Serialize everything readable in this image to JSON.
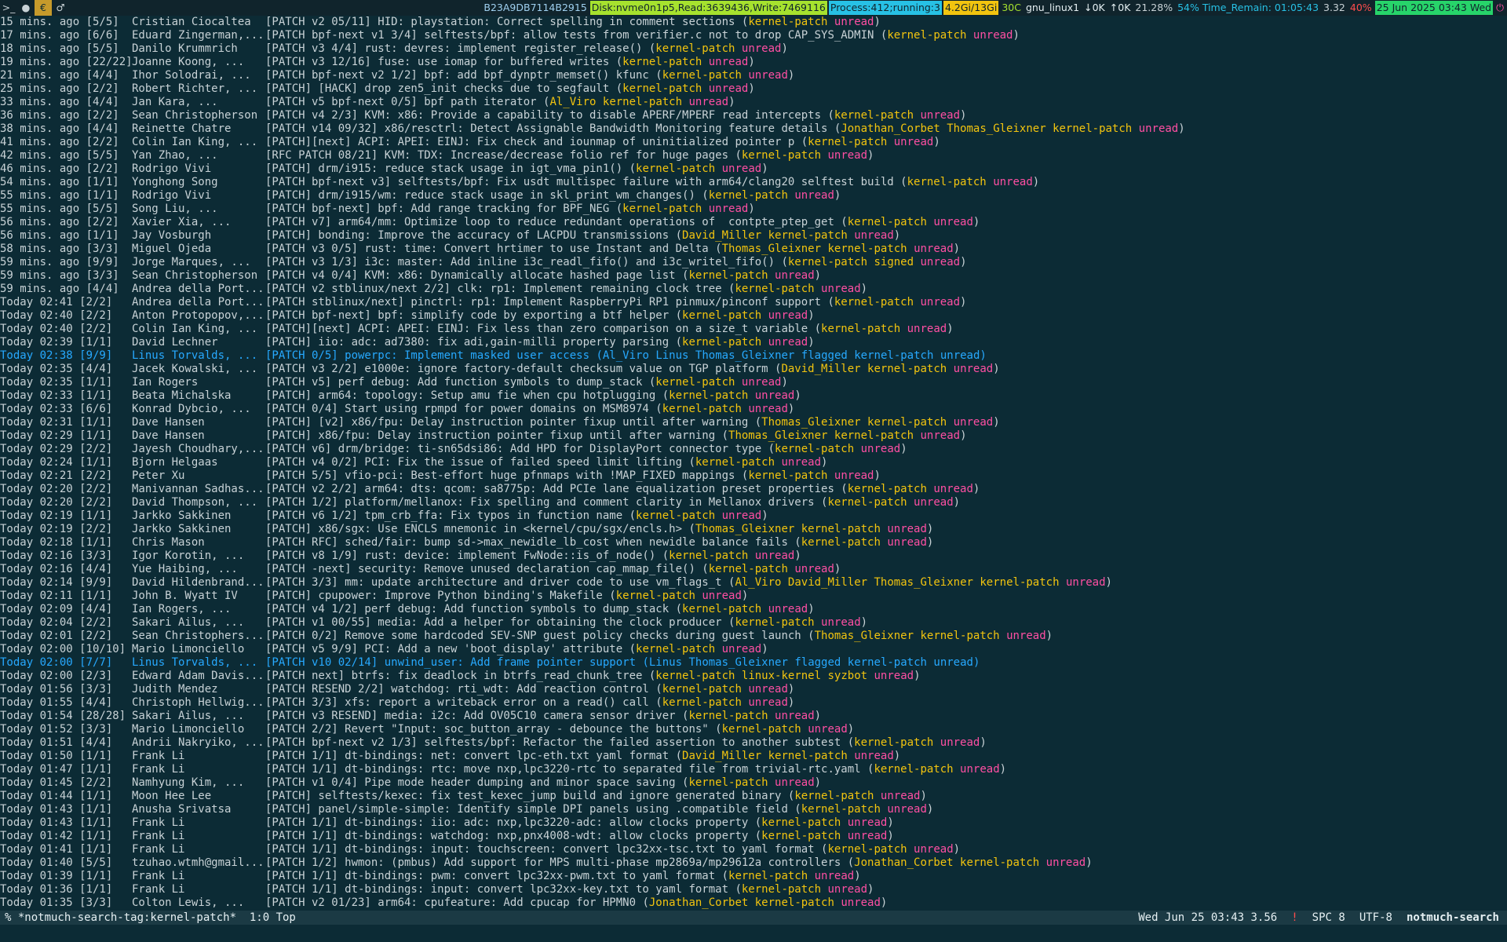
{
  "topbar": {
    "workspaces": [
      ">_",
      "●",
      "€",
      "♂"
    ],
    "active_workspace": 2,
    "hash": "B23A9DB7114B2915",
    "disk": "Disk:nvme0n1p5,Read:3639436,Write:7469116",
    "process": "Process:412;running:3",
    "mem": "4.2Gi/13Gi",
    "temp": "30C",
    "wifi": "gnu_linux1",
    "net_down": "0K",
    "net_up": "0K",
    "cpu": "21.28%",
    "battery": "54% Time_Remain: 01:05:43",
    "load": "3.32",
    "volume": "40%",
    "date": "25 Jun 2025 03:43 Wed"
  },
  "rows": [
    {
      "date": "15 mins. ago [5/5]",
      "author": "Cristian Ciocaltea",
      "subject": "[PATCH v2 05/11] HID: playstation: Correct spelling in comment sections",
      "tags": [
        "kernel-patch",
        "unread"
      ],
      "hl": false
    },
    {
      "date": "17 mins. ago [6/6]",
      "author": "Eduard Zingerman,...",
      "subject": "[PATCH bpf-next v1 3/4] selftests/bpf: allow tests from verifier.c not to drop CAP_SYS_ADMIN",
      "tags": [
        "kernel-patch",
        "unread"
      ],
      "hl": false
    },
    {
      "date": "18 mins. ago [5/5]",
      "author": "Danilo Krummrich",
      "subject": "[PATCH v3 4/4] rust: devres: implement register_release()",
      "tags": [
        "kernel-patch",
        "unread"
      ],
      "hl": false
    },
    {
      "date": "19 mins. ago [22/22]",
      "author": "Joanne Koong, ...",
      "subject": "[PATCH v3 12/16] fuse: use iomap for buffered writes",
      "tags": [
        "kernel-patch",
        "unread"
      ],
      "hl": false
    },
    {
      "date": "21 mins. ago [4/4]",
      "author": "Ihor Solodrai, ...",
      "subject": "[PATCH bpf-next v2 1/2] bpf: add bpf_dynptr_memset() kfunc",
      "tags": [
        "kernel-patch",
        "unread"
      ],
      "hl": false
    },
    {
      "date": "25 mins. ago [2/2]",
      "author": "Robert Richter, ...",
      "subject": "[PATCH] [HACK] drop zen5_init checks due to segfault",
      "tags": [
        "kernel-patch",
        "unread"
      ],
      "hl": false
    },
    {
      "date": "33 mins. ago [4/4]",
      "author": "Jan Kara, ...",
      "subject": "[PATCH v5 bpf-next 0/5] bpf path iterator",
      "tags": [
        "Al_Viro",
        "kernel-patch",
        "unread"
      ],
      "hl": false
    },
    {
      "date": "36 mins. ago [2/2]",
      "author": "Sean Christopherson",
      "subject": "[PATCH v4 2/3] KVM: x86: Provide a capability to disable APERF/MPERF read intercepts",
      "tags": [
        "kernel-patch",
        "unread"
      ],
      "hl": false
    },
    {
      "date": "38 mins. ago [4/4]",
      "author": "Reinette Chatre",
      "subject": "[PATCH v14 09/32] x86/resctrl: Detect Assignable Bandwidth Monitoring feature details",
      "tags": [
        "Jonathan_Corbet",
        "Thomas_Gleixner",
        "kernel-patch",
        "unread"
      ],
      "hl": false
    },
    {
      "date": "41 mins. ago [2/2]",
      "author": "Colin Ian King, ...",
      "subject": "[PATCH][next] ACPI: APEI: EINJ: Fix check and iounmap of uninitialized pointer p",
      "tags": [
        "kernel-patch",
        "unread"
      ],
      "hl": false
    },
    {
      "date": "42 mins. ago [5/5]",
      "author": "Yan Zhao, ...",
      "subject": "[RFC PATCH 08/21] KVM: TDX: Increase/decrease folio ref for huge pages",
      "tags": [
        "kernel-patch",
        "unread"
      ],
      "hl": false
    },
    {
      "date": "46 mins. ago [2/2]",
      "author": "Rodrigo Vivi",
      "subject": "[PATCH] drm/i915: reduce stack usage in igt_vma_pin1()",
      "tags": [
        "kernel-patch",
        "unread"
      ],
      "hl": false
    },
    {
      "date": "54 mins. ago [1/1]",
      "author": "Yonghong Song",
      "subject": "[PATCH bpf-next v3] selftests/bpf: Fix usdt multispec failure with arm64/clang20 selftest build",
      "tags": [
        "kernel-patch",
        "unread"
      ],
      "hl": false
    },
    {
      "date": "55 mins. ago [1/1]",
      "author": "Rodrigo Vivi",
      "subject": "[PATCH] drm/i915/wm: reduce stack usage in skl_print_wm_changes()",
      "tags": [
        "kernel-patch",
        "unread"
      ],
      "hl": false
    },
    {
      "date": "55 mins. ago [5/5]",
      "author": "Song Liu, ...",
      "subject": "[PATCH bpf-next] bpf: Add range tracking for BPF_NEG",
      "tags": [
        "kernel-patch",
        "unread"
      ],
      "hl": false
    },
    {
      "date": "56 mins. ago [2/2]",
      "author": "Xavier Xia, ...",
      "subject": "[PATCH v7] arm64/mm: Optimize loop to reduce redundant operations of  contpte_ptep_get",
      "tags": [
        "kernel-patch",
        "unread"
      ],
      "hl": false
    },
    {
      "date": "56 mins. ago [1/1]",
      "author": "Jay Vosburgh",
      "subject": "[PATCH] bonding: Improve the accuracy of LACPDU transmissions",
      "tags": [
        "David_Miller",
        "kernel-patch",
        "unread"
      ],
      "hl": false
    },
    {
      "date": "58 mins. ago [3/3]",
      "author": "Miguel Ojeda",
      "subject": "[PATCH v3 0/5] rust: time: Convert hrtimer to use Instant and Delta",
      "tags": [
        "Thomas_Gleixner",
        "kernel-patch",
        "unread"
      ],
      "hl": false
    },
    {
      "date": "59 mins. ago [9/9]",
      "author": "Jorge Marques, ...",
      "subject": "[PATCH v3 1/3] i3c: master: Add inline i3c_readl_fifo() and i3c_writel_fifo()",
      "tags": [
        "kernel-patch",
        "signed",
        "unread"
      ],
      "hl": false
    },
    {
      "date": "59 mins. ago [3/3]",
      "author": "Sean Christopherson",
      "subject": "[PATCH v4 0/4] KVM: x86: Dynamically allocate hashed page list",
      "tags": [
        "kernel-patch",
        "unread"
      ],
      "hl": false
    },
    {
      "date": "59 mins. ago [4/4]",
      "author": "Andrea della Port...",
      "subject": "[PATCH v2 stblinux/next 2/2] clk: rp1: Implement remaining clock tree",
      "tags": [
        "kernel-patch",
        "unread"
      ],
      "hl": false
    },
    {
      "date": "Today 02:41 [2/2]",
      "author": "Andrea della Port...",
      "subject": "[PATCH stblinux/next] pinctrl: rp1: Implement RaspberryPi RP1 pinmux/pinconf support",
      "tags": [
        "kernel-patch",
        "unread"
      ],
      "hl": false
    },
    {
      "date": "Today 02:40 [2/2]",
      "author": "Anton Protopopov,...",
      "subject": "[PATCH bpf-next] bpf: simplify code by exporting a btf helper",
      "tags": [
        "kernel-patch",
        "unread"
      ],
      "hl": false
    },
    {
      "date": "Today 02:40 [2/2]",
      "author": "Colin Ian King, ...",
      "subject": "[PATCH][next] ACPI: APEI: EINJ: Fix less than zero comparison on a size_t variable",
      "tags": [
        "kernel-patch",
        "unread"
      ],
      "hl": false
    },
    {
      "date": "Today 02:39 [1/1]",
      "author": "David Lechner",
      "subject": "[PATCH] iio: adc: ad7380: fix adi,gain-milli property parsing",
      "tags": [
        "kernel-patch",
        "unread"
      ],
      "hl": false
    },
    {
      "date": "Today 02:38 [9/9]",
      "author": "Linus Torvalds, ...",
      "subject": "[PATCH 0/5] powerpc: Implement masked user access",
      "tags": [
        "Al_Viro",
        "Linus",
        "Thomas_Gleixner",
        "flagged",
        "kernel-patch",
        "unread"
      ],
      "hl": true
    },
    {
      "date": "Today 02:35 [4/4]",
      "author": "Jacek Kowalski, ...",
      "subject": "[PATCH v3 2/2] e1000e: ignore factory-default checksum value on TGP platform",
      "tags": [
        "David_Miller",
        "kernel-patch",
        "unread"
      ],
      "hl": false
    },
    {
      "date": "Today 02:35 [1/1]",
      "author": "Ian Rogers",
      "subject": "[PATCH v5] perf debug: Add function symbols to dump_stack",
      "tags": [
        "kernel-patch",
        "unread"
      ],
      "hl": false
    },
    {
      "date": "Today 02:33 [1/1]",
      "author": "Beata Michalska",
      "subject": "[PATCH] arm64: topology: Setup amu fie when cpu hotplugging",
      "tags": [
        "kernel-patch",
        "unread"
      ],
      "hl": false
    },
    {
      "date": "Today 02:33 [6/6]",
      "author": "Konrad Dybcio, ...",
      "subject": "[PATCH 0/4] Start using rpmpd for power domains on MSM8974",
      "tags": [
        "kernel-patch",
        "unread"
      ],
      "hl": false
    },
    {
      "date": "Today 02:31 [1/1]",
      "author": "Dave Hansen",
      "subject": "[PATCH] [v2] x86/fpu: Delay instruction pointer fixup until after warning",
      "tags": [
        "Thomas_Gleixner",
        "kernel-patch",
        "unread"
      ],
      "hl": false
    },
    {
      "date": "Today 02:29 [1/1]",
      "author": "Dave Hansen",
      "subject": "[PATCH] x86/fpu: Delay instruction pointer fixup until after warning",
      "tags": [
        "Thomas_Gleixner",
        "kernel-patch",
        "unread"
      ],
      "hl": false
    },
    {
      "date": "Today 02:29 [2/2]",
      "author": "Jayesh Choudhary,...",
      "subject": "[PATCH v6] drm/bridge: ti-sn65dsi86: Add HPD for DisplayPort connector type",
      "tags": [
        "kernel-patch",
        "unread"
      ],
      "hl": false
    },
    {
      "date": "Today 02:24 [1/1]",
      "author": "Bjorn Helgaas",
      "subject": "[PATCH v4 0/2] PCI: Fix the issue of failed speed limit lifting",
      "tags": [
        "kernel-patch",
        "unread"
      ],
      "hl": false
    },
    {
      "date": "Today 02:21 [2/2]",
      "author": "Peter Xu",
      "subject": "[PATCH 5/5] vfio-pci: Best-effort huge pfnmaps with !MAP_FIXED mappings",
      "tags": [
        "kernel-patch",
        "unread"
      ],
      "hl": false
    },
    {
      "date": "Today 02:20 [2/2]",
      "author": "Manivannan Sadhas...",
      "subject": "[PATCH v2 2/2] arm64: dts: qcom: sa8775p: Add PCIe lane equalization preset properties",
      "tags": [
        "kernel-patch",
        "unread"
      ],
      "hl": false
    },
    {
      "date": "Today 02:20 [2/2]",
      "author": "David Thompson, ...",
      "subject": "[PATCH 1/2] platform/mellanox: Fix spelling and comment clarity in Mellanox drivers",
      "tags": [
        "kernel-patch",
        "unread"
      ],
      "hl": false
    },
    {
      "date": "Today 02:19 [1/1]",
      "author": "Jarkko Sakkinen",
      "subject": "[PATCH v6 1/2] tpm_crb_ffa: Fix typos in function name",
      "tags": [
        "kernel-patch",
        "unread"
      ],
      "hl": false
    },
    {
      "date": "Today 02:19 [2/2]",
      "author": "Jarkko Sakkinen",
      "subject": "[PATCH] x86/sgx: Use ENCLS mnemonic in <kernel/cpu/sgx/encls.h>",
      "tags": [
        "Thomas_Gleixner",
        "kernel-patch",
        "unread"
      ],
      "hl": false
    },
    {
      "date": "Today 02:18 [1/1]",
      "author": "Chris Mason",
      "subject": "[PATCH RFC] sched/fair: bump sd->max_newidle_lb_cost when newidle balance fails",
      "tags": [
        "kernel-patch",
        "unread"
      ],
      "hl": false
    },
    {
      "date": "Today 02:16 [3/3]",
      "author": "Igor Korotin, ...",
      "subject": "[PATCH v8 1/9] rust: device: implement FwNode::is_of_node()",
      "tags": [
        "kernel-patch",
        "unread"
      ],
      "hl": false
    },
    {
      "date": "Today 02:16 [4/4]",
      "author": "Yue Haibing, ...",
      "subject": "[PATCH -next] security: Remove unused declaration cap_mmap_file()",
      "tags": [
        "kernel-patch",
        "unread"
      ],
      "hl": false
    },
    {
      "date": "Today 02:14 [9/9]",
      "author": "David Hildenbrand...",
      "subject": "[PATCH 3/3] mm: update architecture and driver code to use vm_flags_t",
      "tags": [
        "Al_Viro",
        "David_Miller",
        "Thomas_Gleixner",
        "kernel-patch",
        "unread"
      ],
      "hl": false
    },
    {
      "date": "Today 02:11 [1/1]",
      "author": "John B. Wyatt IV",
      "subject": "[PATCH] cpupower: Improve Python binding's Makefile",
      "tags": [
        "kernel-patch",
        "unread"
      ],
      "hl": false
    },
    {
      "date": "Today 02:09 [4/4]",
      "author": "Ian Rogers, ...",
      "subject": "[PATCH v4 1/2] perf debug: Add function symbols to dump_stack",
      "tags": [
        "kernel-patch",
        "unread"
      ],
      "hl": false
    },
    {
      "date": "Today 02:04 [2/2]",
      "author": "Sakari Ailus, ...",
      "subject": "[PATCH v1 00/55] media: Add a helper for obtaining the clock producer",
      "tags": [
        "kernel-patch",
        "unread"
      ],
      "hl": false
    },
    {
      "date": "Today 02:01 [2/2]",
      "author": "Sean Christophers...",
      "subject": "[PATCH 0/2] Remove some hardcoded SEV-SNP guest policy checks during guest launch",
      "tags": [
        "Thomas_Gleixner",
        "kernel-patch",
        "unread"
      ],
      "hl": false
    },
    {
      "date": "Today 02:00 [10/10]",
      "author": "Mario Limonciello",
      "subject": "[PATCH v5 9/9] PCI: Add a new 'boot_display' attribute",
      "tags": [
        "kernel-patch",
        "unread"
      ],
      "hl": false
    },
    {
      "date": "Today 02:00 [7/7]",
      "author": "Linus Torvalds, ...",
      "subject": "[PATCH v10 02/14] unwind_user: Add frame pointer support",
      "tags": [
        "Linus",
        "Thomas_Gleixner",
        "flagged",
        "kernel-patch",
        "unread"
      ],
      "hl": true
    },
    {
      "date": "Today 02:00 [2/3]",
      "author": "Edward Adam Davis...",
      "subject": "[PATCH next] btrfs: fix deadlock in btrfs_read_chunk_tree",
      "tags": [
        "kernel-patch",
        "linux-kernel",
        "syzbot",
        "unread"
      ],
      "hl": false
    },
    {
      "date": "Today 01:56 [3/3]",
      "author": "Judith Mendez",
      "subject": "[PATCH RESEND 2/2] watchdog: rti_wdt: Add reaction control",
      "tags": [
        "kernel-patch",
        "unread"
      ],
      "hl": false
    },
    {
      "date": "Today 01:55 [4/4]",
      "author": "Christoph Hellwig...",
      "subject": "[PATCH 3/3] xfs: report a writeback error on a read() call",
      "tags": [
        "kernel-patch",
        "unread"
      ],
      "hl": false
    },
    {
      "date": "Today 01:54 [28/28]",
      "author": "Sakari Ailus, ...",
      "subject": "[PATCH v3 RESEND] media: i2c: Add OV05C10 camera sensor driver",
      "tags": [
        "kernel-patch",
        "unread"
      ],
      "hl": false
    },
    {
      "date": "Today 01:52 [3/3]",
      "author": "Mario Limonciello",
      "subject": "[PATCH 2/2] Revert \"Input: soc_button_array - debounce the buttons\"",
      "tags": [
        "kernel-patch",
        "unread"
      ],
      "hl": false
    },
    {
      "date": "Today 01:51 [4/4]",
      "author": "Andrii Nakryiko, ...",
      "subject": "[PATCH bpf-next v2 1/3] selftests/bpf: Refactor the failed assertion to another subtest",
      "tags": [
        "kernel-patch",
        "unread"
      ],
      "hl": false
    },
    {
      "date": "Today 01:50 [1/1]",
      "author": "Frank Li",
      "subject": "[PATCH 1/1] dt-bindings: net: convert lpc-eth.txt yaml format",
      "tags": [
        "David_Miller",
        "kernel-patch",
        "unread"
      ],
      "hl": false
    },
    {
      "date": "Today 01:47 [1/1]",
      "author": "Frank Li",
      "subject": "[PATCH 1/1] dt-bindings: rtc: move nxp,lpc3220-rtc to separated file from trivial-rtc.yaml",
      "tags": [
        "kernel-patch",
        "unread"
      ],
      "hl": false
    },
    {
      "date": "Today 01:45 [2/2]",
      "author": "Namhyung Kim, ...",
      "subject": "[PATCH v1 0/4] Pipe mode header dumping and minor space saving",
      "tags": [
        "kernel-patch",
        "unread"
      ],
      "hl": false
    },
    {
      "date": "Today 01:44 [1/1]",
      "author": "Moon Hee Lee",
      "subject": "[PATCH] selftests/kexec: fix test_kexec_jump build and ignore generated binary",
      "tags": [
        "kernel-patch",
        "unread"
      ],
      "hl": false
    },
    {
      "date": "Today 01:43 [1/1]",
      "author": "Anusha Srivatsa",
      "subject": "[PATCH] panel/simple-simple: Identify simple DPI panels using .compatible field",
      "tags": [
        "kernel-patch",
        "unread"
      ],
      "hl": false
    },
    {
      "date": "Today 01:43 [1/1]",
      "author": "Frank Li",
      "subject": "[PATCH 1/1] dt-bindings: iio: adc: nxp,lpc3220-adc: allow clocks property",
      "tags": [
        "kernel-patch",
        "unread"
      ],
      "hl": false
    },
    {
      "date": "Today 01:42 [1/1]",
      "author": "Frank Li",
      "subject": "[PATCH 1/1] dt-bindings: watchdog: nxp,pnx4008-wdt: allow clocks property",
      "tags": [
        "kernel-patch",
        "unread"
      ],
      "hl": false
    },
    {
      "date": "Today 01:41 [1/1]",
      "author": "Frank Li",
      "subject": "[PATCH 1/1] dt-bindings: input: touchscreen: convert lpc32xx-tsc.txt to yaml format",
      "tags": [
        "kernel-patch",
        "unread"
      ],
      "hl": false
    },
    {
      "date": "Today 01:40 [5/5]",
      "author": "tzuhao.wtmh@gmail...",
      "subject": "[PATCH 1/2] hwmon: (pmbus) Add support for MPS multi-phase mp2869a/mp29612a controllers",
      "tags": [
        "Jonathan_Corbet",
        "kernel-patch",
        "unread"
      ],
      "hl": false
    },
    {
      "date": "Today 01:39 [1/1]",
      "author": "Frank Li",
      "subject": "[PATCH 1/1] dt-bindings: pwm: convert lpc32xx-pwm.txt to yaml format",
      "tags": [
        "kernel-patch",
        "unread"
      ],
      "hl": false
    },
    {
      "date": "Today 01:36 [1/1]",
      "author": "Frank Li",
      "subject": "[PATCH 1/1] dt-bindings: input: convert lpc32xx-key.txt to yaml format",
      "tags": [
        "kernel-patch",
        "unread"
      ],
      "hl": false
    },
    {
      "date": "Today 01:35 [3/3]",
      "author": "Colton Lewis, ...",
      "subject": "[PATCH v2 01/23] arm64: cpufeature: Add cpucap for HPMN0",
      "tags": [
        "Jonathan_Corbet",
        "kernel-patch",
        "unread"
      ],
      "hl": false
    }
  ],
  "modeline": {
    "left": "% *notmuch-search-tag:kernel-patch*  1:0 Top",
    "datetime": "Wed Jun 25 03:43 3.56",
    "warn": "!",
    "indent": "SPC 8",
    "encoding": "UTF-8",
    "mode": "notmuch-search"
  }
}
